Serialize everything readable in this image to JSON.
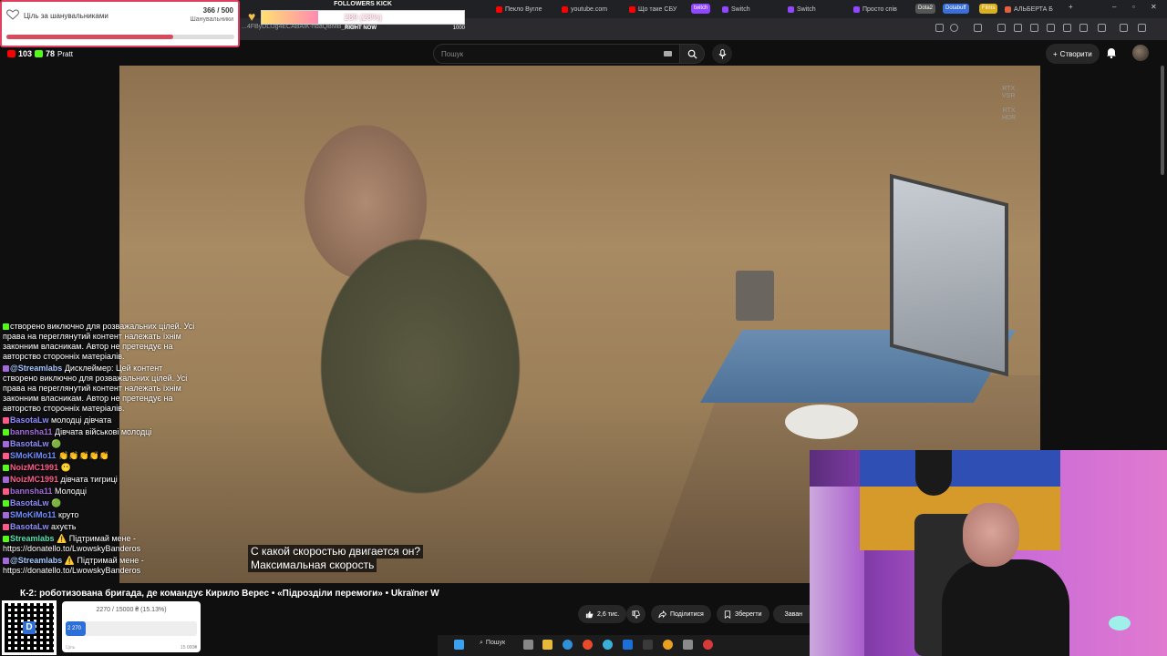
{
  "browser": {
    "tabs": [
      {
        "label": "Пекло Вугле",
        "color": "#ff0000"
      },
      {
        "label": "youtube.com",
        "color": "#ff0000"
      },
      {
        "label": "Що таке СБУ",
        "color": "#ff0000"
      },
      {
        "label": "Switch",
        "color": "#9146ff"
      },
      {
        "label": "Switch",
        "color": "#9146ff"
      },
      {
        "label": "Просто спів",
        "color": "#9146ff"
      },
      {
        "label": "АЛЬБЕРТА Б",
        "color": "#e06040"
      }
    ],
    "pills": [
      {
        "label": "twitch",
        "color": "#9146ff"
      },
      {
        "label": "Dota2",
        "color": "#555"
      },
      {
        "label": "Dotabuff",
        "color": "#3a6fd8"
      },
      {
        "label": "Films",
        "color": "#d8b020"
      }
    ],
    "url_fragment": "...4FByDLIJg4ECABAIK-ndaQBMB_zx9..."
  },
  "youtube": {
    "search_placeholder": "Пошук",
    "create_label": "Створити",
    "video_title": "К-2: роботизована бригада, де командує Кирило Верес • «Підрозділи перемоги» • Ukraïner W",
    "rtx_vsr": "RTX\nVSR",
    "rtx_hdr": "RTX\nHDR",
    "subtitle_line1": "С какой скоростью двигается он?",
    "subtitle_line2": "Максимальная скорость",
    "actions": {
      "likes": "2,6 тис.",
      "share": "Поділитися",
      "save": "Зберегти",
      "download": "Заван"
    }
  },
  "overlay": {
    "followers_goal": {
      "title": "Ціль за шанувальниками",
      "current": 366,
      "target": 500,
      "count_text": "366 / 500",
      "sub": "Шанувальники"
    },
    "kick": {
      "title": "FOLLOWERS KICK",
      "value_text": "289 (28%)",
      "percent": 28,
      "sub": "RIGHT NOW",
      "max": "1000"
    },
    "counters": {
      "youtube": "103",
      "kick": "78",
      "label": "Pratt"
    },
    "donation": {
      "summary": "2270 / 15000 ₴ (15.13%)",
      "bar_label": "2 270",
      "percent": 15.13,
      "left_label": "Ціль",
      "right_label": "15 000₴"
    }
  },
  "chat": [
    {
      "name": "",
      "name_color": "#ffffff",
      "text": "створено виключно для розважальних цілей. Усі права на переглянутий контент належать їхнім законним власникам. Автор не претендує на авторство сторонніх матеріалів."
    },
    {
      "name": "@Streamlabs",
      "name_color": "#a6c8ff",
      "text": "Дисклеймер: Цей контент створено виключно для розважальних цілей. Усі права на переглянутий контент належать їхнім законним власникам. Автор не претендує на авторство сторонніх матеріалів."
    },
    {
      "name": "BasotaLw",
      "name_color": "#8f8cff",
      "text": "молодці дівчата"
    },
    {
      "name": "bannsha11",
      "name_color": "#a26ad8",
      "text": "Дівчата військові молодці"
    },
    {
      "name": "BasotaLw",
      "name_color": "#8f8cff",
      "text": "🟢"
    },
    {
      "name": "SMoKiMo11",
      "name_color": "#6e8cff",
      "text": "👏👏👏👏👏"
    },
    {
      "name": "NoizMC1991",
      "name_color": "#ff5a8a",
      "text": "😶"
    },
    {
      "name": "NoizMC1991",
      "name_color": "#ff5a8a",
      "text": "дівчата тигриці"
    },
    {
      "name": "bannsha11",
      "name_color": "#a26ad8",
      "text": "Молодці"
    },
    {
      "name": "BasotaLw",
      "name_color": "#8f8cff",
      "text": "🟢"
    },
    {
      "name": "SMoKiMo11",
      "name_color": "#6e8cff",
      "text": "круто"
    },
    {
      "name": "BasotaLw",
      "name_color": "#8f8cff",
      "text": "ахуєть"
    },
    {
      "name": "Streamlabs",
      "name_color": "#53e0b0",
      "text": "⚠️ Підтримай мене - https://donatello.to/LwowskyBanderos"
    },
    {
      "name": "@Streamlabs",
      "name_color": "#a6c8ff",
      "text": "⚠️ Підтримай мене - https://donatello.to/LwowskyBanderos"
    }
  ],
  "taskbar": {
    "search_label": "Пошук"
  },
  "colors": {
    "yt_bg": "#0f0f0f",
    "accent_red": "#d64c5c",
    "kick_green": "#53fc18",
    "twitch_purple": "#9146ff"
  }
}
